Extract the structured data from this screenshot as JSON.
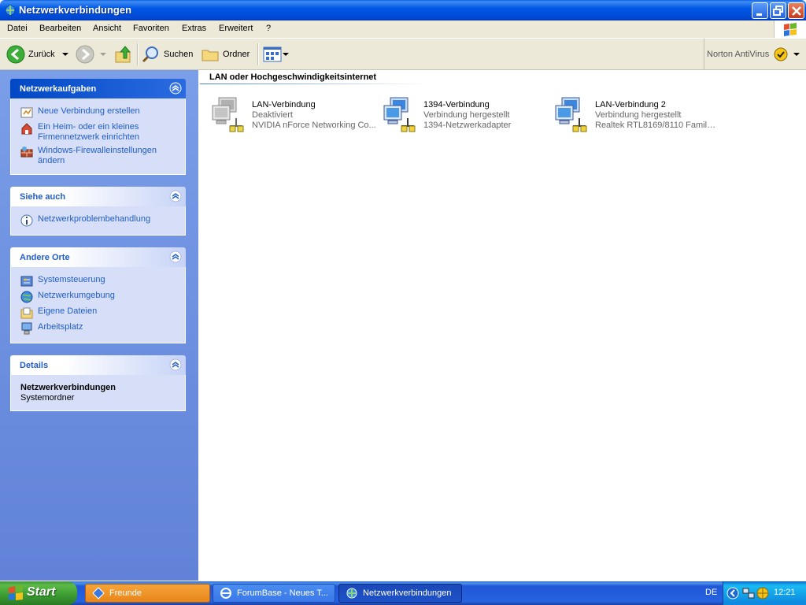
{
  "window": {
    "title": "Netzwerkverbindungen"
  },
  "menu": [
    "Datei",
    "Bearbeiten",
    "Ansicht",
    "Favoriten",
    "Extras",
    "Erweitert",
    "?"
  ],
  "toolbar": {
    "back_label": "Zurück",
    "search_label": "Suchen",
    "folders_label": "Ordner",
    "norton_label": "Norton AntiVirus"
  },
  "sidebar": {
    "tasks": {
      "title": "Netzwerkaufgaben",
      "items": [
        {
          "label": "Neue Verbindung erstellen"
        },
        {
          "label_line1": "Ein Heim- oder ein kleines",
          "label_line2": "Firmennetzwerk einrichten"
        },
        {
          "label_line1": "Windows-Firewalleinstellungen",
          "label_line2": "ändern"
        }
      ]
    },
    "see_also": {
      "title": "Siehe auch",
      "items": [
        {
          "label": "Netzwerkproblembehandlung"
        }
      ]
    },
    "other_places": {
      "title": "Andere Orte",
      "items": [
        {
          "label": "Systemsteuerung"
        },
        {
          "label": "Netzwerkumgebung"
        },
        {
          "label": "Eigene Dateien"
        },
        {
          "label": "Arbeitsplatz"
        }
      ]
    },
    "details": {
      "title": "Details",
      "name": "Netzwerkverbindungen",
      "type": "Systemordner"
    }
  },
  "main": {
    "group_title": "LAN oder Hochgeschwindigkeitsinternet",
    "connections": [
      {
        "name": "LAN-Verbindung",
        "status": "Deaktiviert",
        "device": "NVIDIA nForce Networking Co...",
        "enabled": false
      },
      {
        "name": "1394-Verbindung",
        "status": "Verbindung hergestellt",
        "device": "1394-Netzwerkadapter",
        "enabled": true
      },
      {
        "name": "LAN-Verbindung 2",
        "status": "Verbindung hergestellt",
        "device": "Realtek RTL8169/8110 Family ...",
        "enabled": true
      }
    ]
  },
  "taskbar": {
    "start_label": "Start",
    "tasks": [
      {
        "label": "Freunde"
      },
      {
        "label": "ForumBase - Neues T..."
      },
      {
        "label": "Netzwerkverbindungen"
      }
    ],
    "language": "DE",
    "clock": "12:21"
  }
}
